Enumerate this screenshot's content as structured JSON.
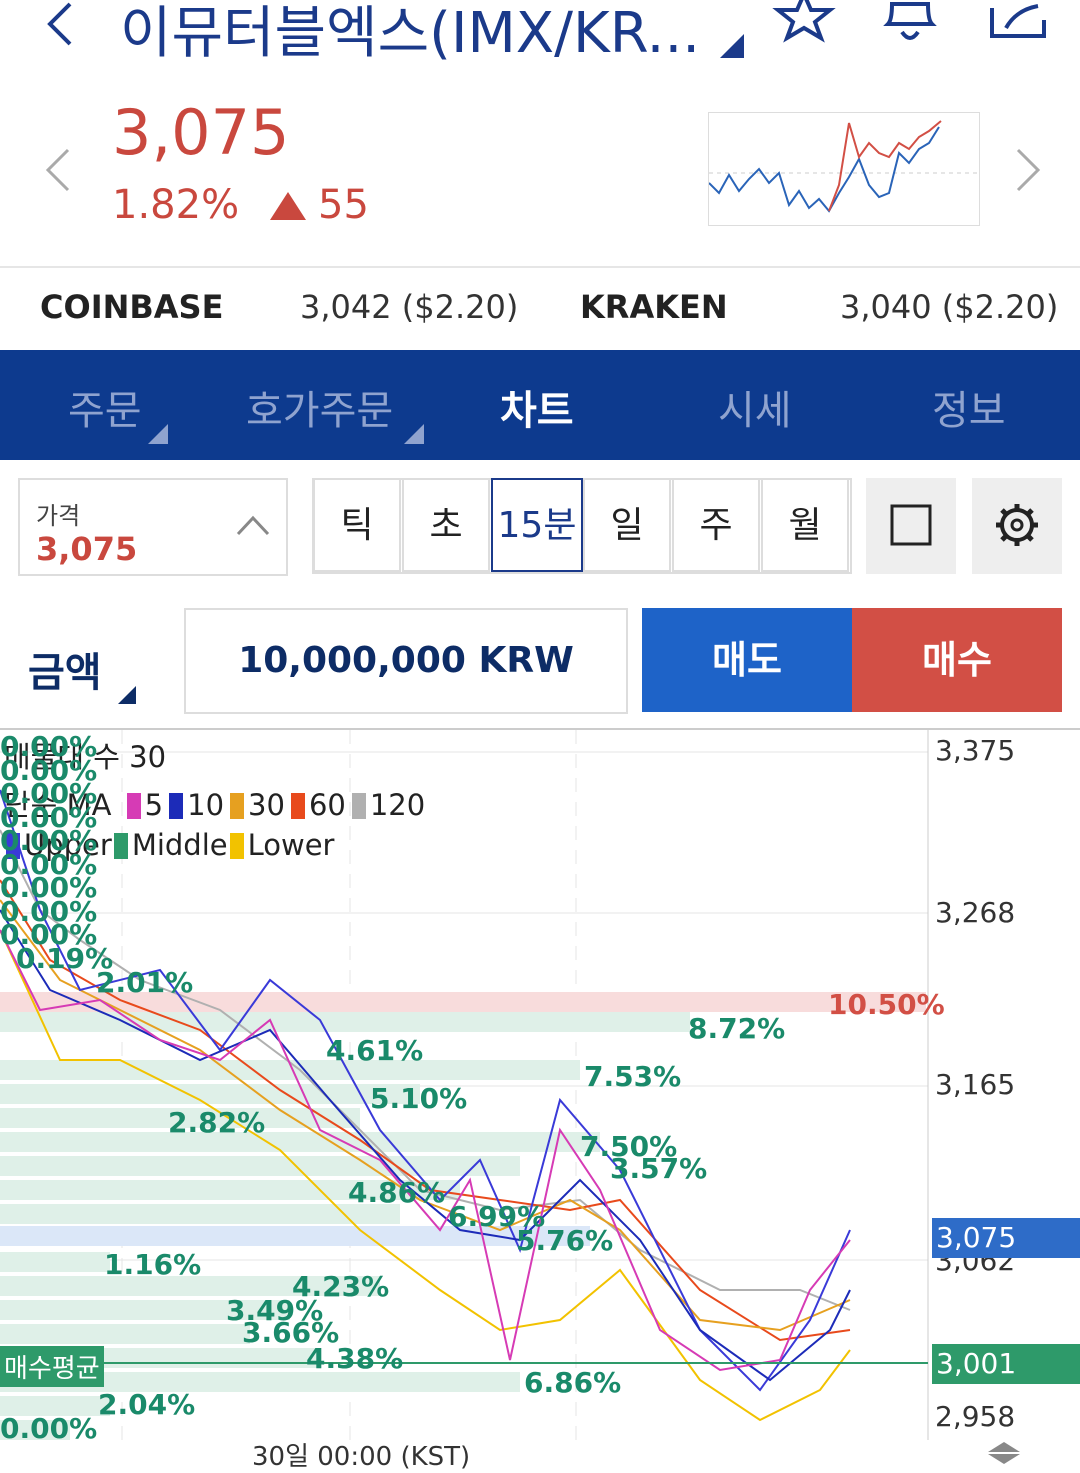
{
  "header": {
    "title": "이뮤터블엑스(IMX/KR...",
    "icons": [
      "back-icon",
      "star-icon",
      "bell-icon",
      "share-icon"
    ]
  },
  "price": {
    "current": "3,075",
    "change_pct": "1.82%",
    "change_abs": "55",
    "color": "#c9483e"
  },
  "exchanges": [
    {
      "name": "COINBASE",
      "value": "3,042 ($2.20)"
    },
    {
      "name": "KRAKEN",
      "value": "3,040 ($2.20)"
    }
  ],
  "tabs": [
    {
      "label": "주문"
    },
    {
      "label": "호가주문"
    },
    {
      "label": "차트"
    },
    {
      "label": "시세"
    },
    {
      "label": "정보"
    }
  ],
  "controls": {
    "price_label": "가격",
    "price_value": "3,075",
    "intervals": [
      "틱",
      "초",
      "15분",
      "일",
      "주",
      "월"
    ],
    "selected_interval": "15분"
  },
  "order": {
    "amount_label": "금액",
    "amount_value": "10,000,000 KRW",
    "sell_label": "매도",
    "buy_label": "매수"
  },
  "chart": {
    "legend_row1": "매물대 수 30",
    "legend_row2": "단순 MA",
    "ma_periods": [
      "5",
      "10",
      "30",
      "60",
      "120"
    ],
    "ma_colors": [
      "#d63bb5",
      "#1c2bb8",
      "#e6a020",
      "#e84a1c",
      "#b0b0b0"
    ],
    "bb_labels": [
      "Upper",
      "Middle",
      "Lower"
    ],
    "bb_colors": [
      "#3a3ad8",
      "#2e9a6a",
      "#f2c200"
    ],
    "y_ticks": [
      "3,375",
      "3,268",
      "3,165",
      "3,062",
      "2,958"
    ],
    "current_tag": "3,075",
    "avg_tag": "3,001",
    "avg_label": "매수평균",
    "resistance_pct": "10.50%",
    "x_label": "30일 00:00 (KST)",
    "left_pcts": [
      "0.00%",
      "0.00%",
      "0.00%",
      "0.00%",
      "0.00%",
      "0.00%",
      "0.00%",
      "0.00%",
      "0.00%",
      "0.19%"
    ],
    "volume_profile_pcts": [
      "2.01%",
      "8.72%",
      "4.61%",
      "7.53%",
      "2.82%",
      "5.10%",
      "7.50%",
      "3.57%",
      "4.86%",
      "6.99%",
      "5.76%",
      "1.16%",
      "4.23%",
      "3.49%",
      "3.66%",
      "4.38%",
      "6.86%",
      "2.04%",
      "0.00%"
    ]
  }
}
